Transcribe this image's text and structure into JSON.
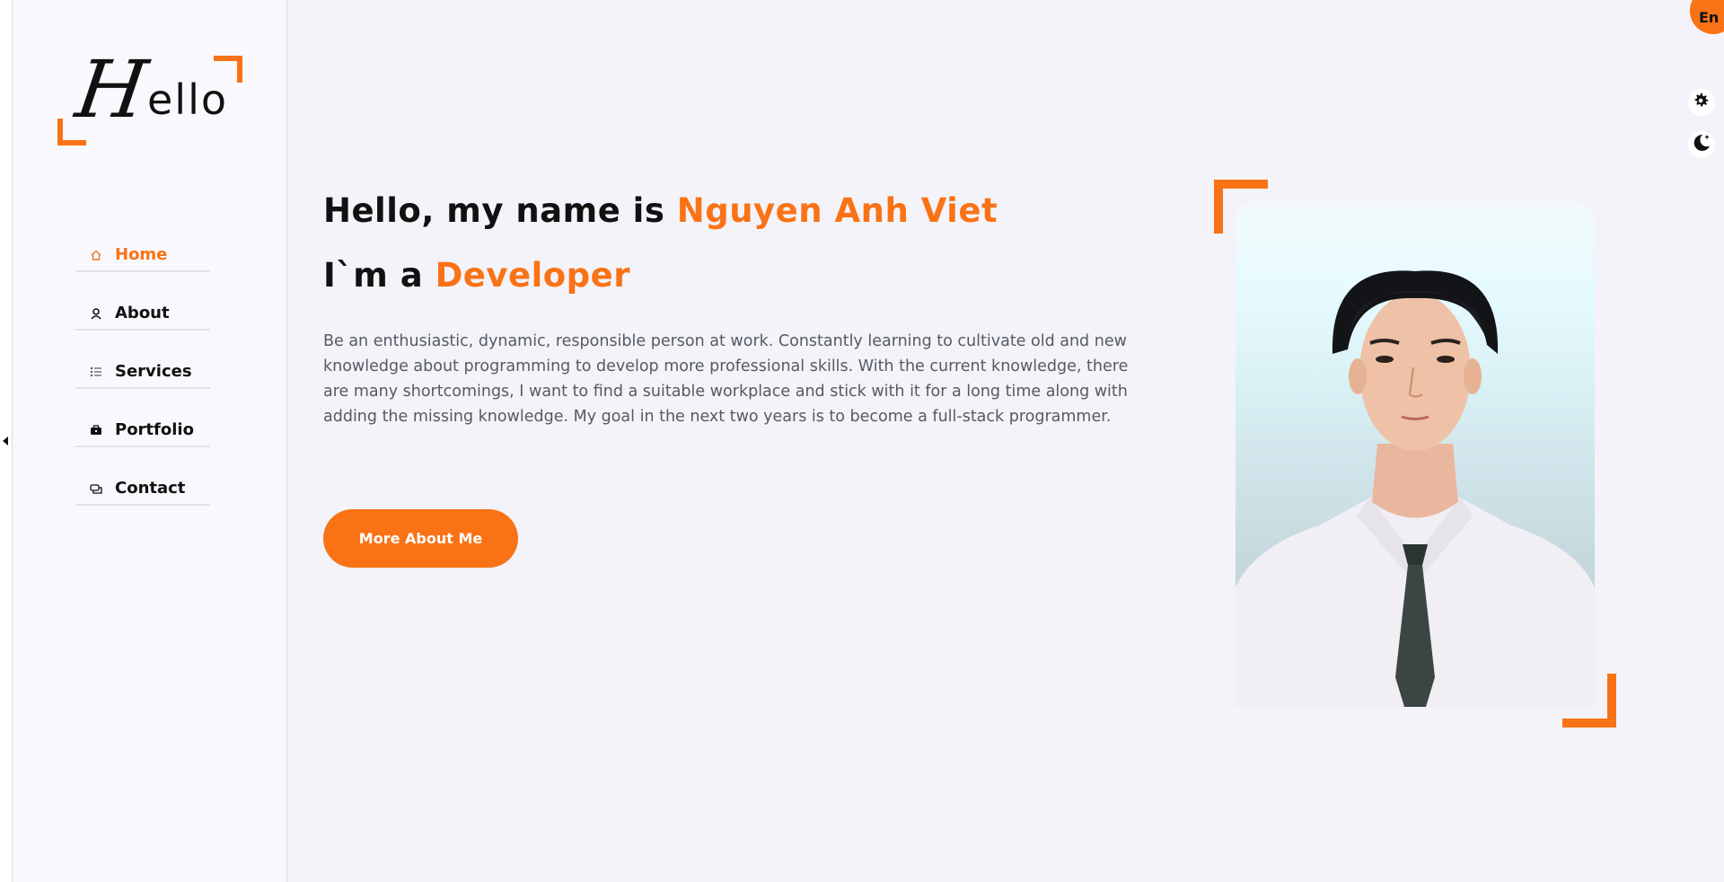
{
  "logo": {
    "initial": "H",
    "rest": "ello"
  },
  "nav": {
    "items": [
      {
        "label": "Home",
        "icon": "home-icon",
        "active": true
      },
      {
        "label": "About",
        "icon": "user-icon",
        "active": false
      },
      {
        "label": "Services",
        "icon": "list-icon",
        "active": false
      },
      {
        "label": "Portfolio",
        "icon": "briefcase-icon",
        "active": false
      },
      {
        "label": "Contact",
        "icon": "chat-icon",
        "active": false
      }
    ]
  },
  "hero": {
    "greeting_prefix": "Hello, my name is ",
    "name": "Nguyen Anh Viet",
    "role_prefix": "I`m a ",
    "role": "Developer",
    "description": "Be an enthusiastic, dynamic, responsible person at work. Constantly learning to cultivate old and new knowledge about programming to develop more professional skills. With the current knowledge, there are many shortcomings, I want to find a suitable workplace and stick with it for a long time along with adding the missing knowledge. My goal in the next two years is to become a full-stack programmer.",
    "cta_label": "More About Me"
  },
  "controls": {
    "language": "En",
    "settings_icon": "gear-icon",
    "theme_icon": "moon-icon"
  },
  "colors": {
    "accent": "#f97316",
    "text": "#111111",
    "muted": "#555a63",
    "background": "#f3f3f9"
  }
}
